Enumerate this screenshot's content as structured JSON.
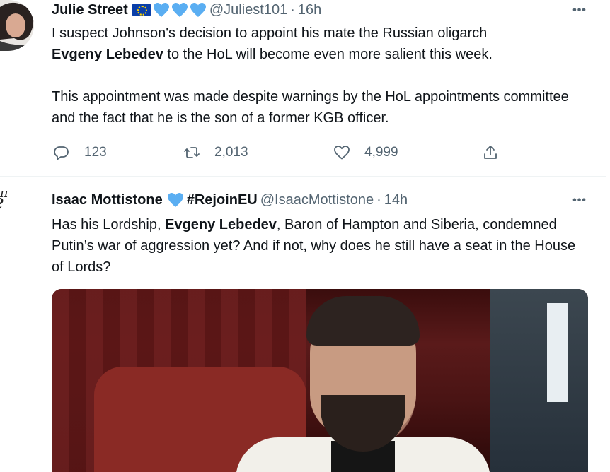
{
  "tweets": [
    {
      "name": "Julie Street",
      "handle": "@Juliest101",
      "dot": "·",
      "time": "16h",
      "text_parts": {
        "p1_a": "I suspect Johnson's decision to appoint his mate the Russian oligarch",
        "p1_bold": "Evgeny Lebedev",
        "p1_b": " to the HoL will become even more salient this week.",
        "p2": "This appointment was made despite warnings by the HoL appointments committee and the fact that he is the son of a former KGB officer."
      },
      "replies": "123",
      "retweets": "2,013",
      "likes": "4,999",
      "badges": [
        "eu-flag-icon",
        "blue-heart-icon",
        "blue-heart-icon",
        "blue-heart-icon"
      ],
      "colors": {
        "heart": "#5aaef2",
        "flag": "#0a3fa8"
      }
    },
    {
      "name": "Isaac Mottistone",
      "hashtag": "#RejoinEU",
      "handle": "@IsaacMottistone",
      "dot": "·",
      "time": "14h",
      "avatar_glyph_base": "e",
      "avatar_glyph_sup": "iπ",
      "text_parts": {
        "a": "Has his Lordship, ",
        "bold": "Evgeny Lebedev",
        "b": ", Baron of Hampton and Siberia, condemned Putin’s war of aggression yet? And if not, why does he still have a seat in the House of Lords?"
      },
      "badges": [
        "blue-heart-icon"
      ]
    }
  ],
  "more_glyph": "•••",
  "colors": {
    "text": "#0f1419",
    "secondary": "#536471",
    "border": "#eff3f4"
  }
}
